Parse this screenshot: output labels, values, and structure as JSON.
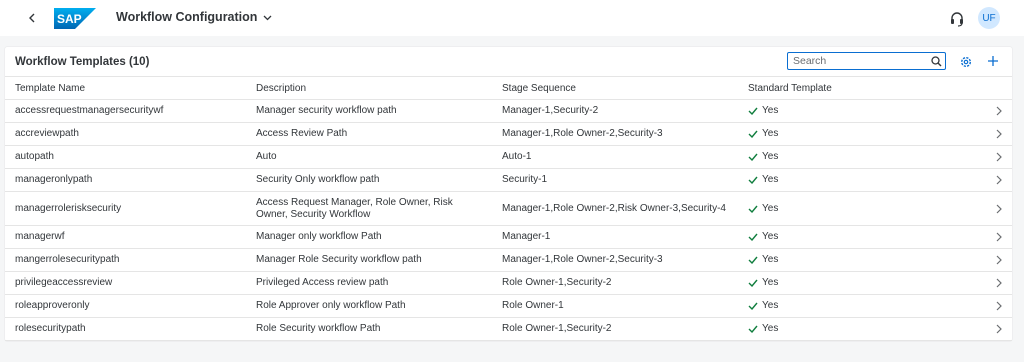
{
  "shell": {
    "title": "Workflow Configuration",
    "user_initials": "UF",
    "brand_color": "#0a6ed1"
  },
  "table": {
    "title": "Workflow Templates (10)",
    "search_placeholder": "Search",
    "columns": [
      "Template Name",
      "Description",
      "Stage Sequence",
      "Standard Template"
    ],
    "rows": [
      {
        "name": "accessrequestmanagersecuritywf",
        "description": "Manager security workflow path",
        "stages": "Manager-1,Security-2",
        "standard": "Yes"
      },
      {
        "name": "accreviewpath",
        "description": "Access Review Path",
        "stages": "Manager-1,Role Owner-2,Security-3",
        "standard": "Yes"
      },
      {
        "name": "autopath",
        "description": "Auto",
        "stages": "Auto-1",
        "standard": "Yes"
      },
      {
        "name": "manageronlypath",
        "description": "Security Only workflow path",
        "stages": "Security-1",
        "standard": "Yes"
      },
      {
        "name": "managerrolerisksecurity",
        "description": "Access Request Manager, Role Owner, Risk Owner, Security Workflow",
        "stages": "Manager-1,Role Owner-2,Risk Owner-3,Security-4",
        "standard": "Yes"
      },
      {
        "name": "managerwf",
        "description": "Manager only workflow Path",
        "stages": "Manager-1",
        "standard": "Yes"
      },
      {
        "name": "mangerrolesecuritypath",
        "description": "Manager Role Security workflow path",
        "stages": "Manager-1,Role Owner-2,Security-3",
        "standard": "Yes"
      },
      {
        "name": "privilegeaccessreview",
        "description": "Privileged Access review path",
        "stages": "Role Owner-1,Security-2",
        "standard": "Yes"
      },
      {
        "name": "roleapproveronly",
        "description": "Role Approver only workflow Path",
        "stages": "Role Owner-1",
        "standard": "Yes"
      },
      {
        "name": "rolesecuritypath",
        "description": "Role Security workflow Path",
        "stages": "Role Owner-1,Security-2",
        "standard": "Yes"
      }
    ]
  },
  "colors": {
    "check": "#107e3e",
    "accent": "#0a6ed1"
  }
}
